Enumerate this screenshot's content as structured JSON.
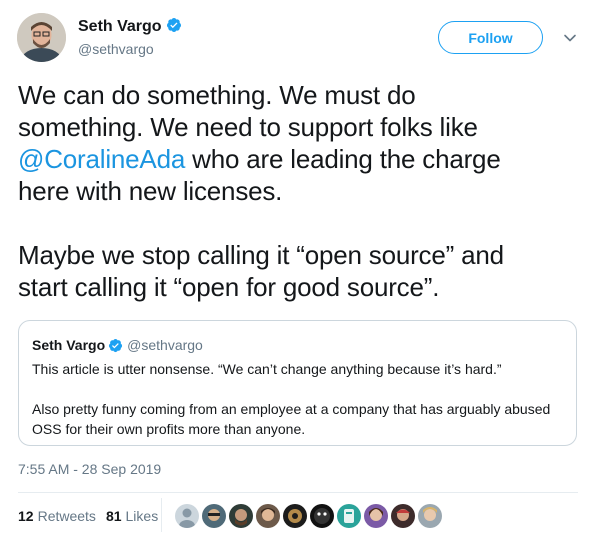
{
  "author": {
    "name": "Seth Vargo",
    "handle": "@sethvargo",
    "verified_icon": "verified-badge-icon"
  },
  "follow_label": "Follow",
  "tweet": {
    "line1": "We can do something. We must do",
    "line2": "something. We need to support folks like",
    "mention": "@CoralineAda",
    "line3_rest": " who are leading the charge",
    "line4": "here with new licenses.",
    "line5": "Maybe we stop calling it “open source” and",
    "line6": "start calling it “open for good source”."
  },
  "quoted": {
    "name": "Seth Vargo",
    "handle": "@sethvargo",
    "para1": "This article is utter nonsense. “We can’t change anything because it’s hard.”",
    "para2_line1": "Also pretty funny coming from an employee at a company that has arguably abused",
    "para2_line2": "OSS for their own profits more than anyone."
  },
  "timestamp": "7:55 AM - 28 Sep 2019",
  "stats": {
    "retweets_count": "12",
    "retweets_label": "Retweets",
    "likes_count": "81",
    "likes_label": "Likes"
  },
  "colors": {
    "accent": "#1da1f2",
    "mention": "#1b95e0",
    "muted": "#657786"
  }
}
